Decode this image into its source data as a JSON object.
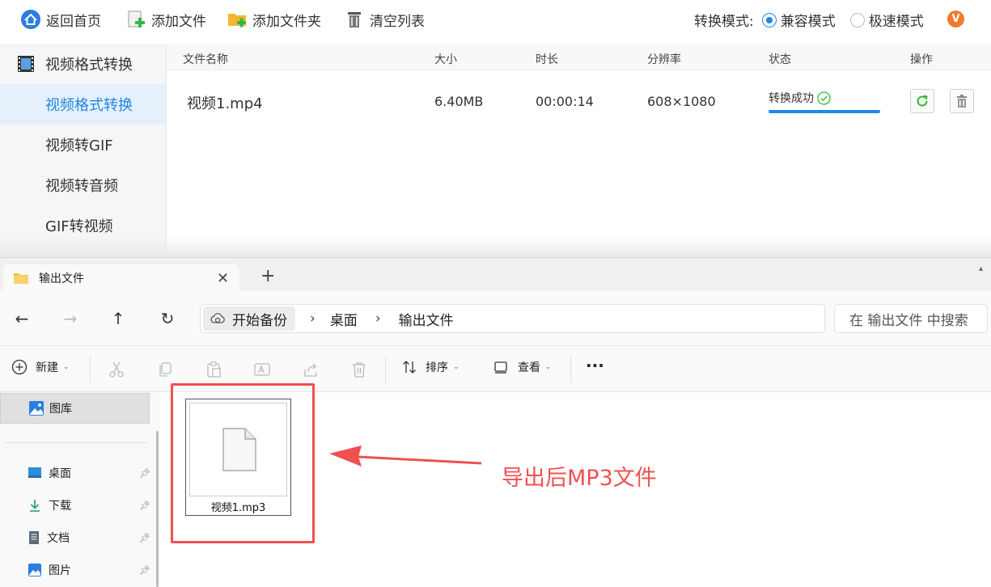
{
  "toolbar": {
    "home": "返回首页",
    "add_file": "添加文件",
    "add_folder": "添加文件夹",
    "clear_list": "清空列表"
  },
  "mode": {
    "label": "转换模式:",
    "options": [
      {
        "label": "兼容模式",
        "selected": true
      },
      {
        "label": "极速模式",
        "selected": false
      }
    ],
    "vip_badge": "V"
  },
  "sidebar": {
    "heading": "视频格式转换",
    "items": [
      {
        "label": "视频格式转换",
        "active": true
      },
      {
        "label": "视频转GIF",
        "active": false
      },
      {
        "label": "视频转音频",
        "active": false
      },
      {
        "label": "GIF转视频",
        "active": false
      }
    ]
  },
  "table": {
    "headers": [
      "文件名称",
      "大小",
      "时长",
      "分辨率",
      "状态",
      "操作"
    ],
    "rows": [
      {
        "name": "视频1.mp4",
        "size": "6.40MB",
        "duration": "00:00:14",
        "resolution": "608×1080",
        "status": "转换成功",
        "progress": 1.0
      }
    ]
  },
  "explorer": {
    "tab_title": "输出文件",
    "breadcrumbs": [
      "开始备份",
      "桌面",
      "输出文件"
    ],
    "search_placeholder": "在 输出文件 中搜索",
    "commands": {
      "new": "新建",
      "sort": "排序",
      "view": "查看",
      "more": "···"
    },
    "nav_gallery": "图库",
    "nav_items": [
      "桌面",
      "下载",
      "文档",
      "图片"
    ],
    "file_name": "视频1.mp3",
    "annotation": "导出后MP3文件"
  },
  "colors": {
    "accent": "#1e88e5",
    "annotation": "#f05050",
    "vip": "#f07a2a",
    "success": "#2eb82e"
  }
}
